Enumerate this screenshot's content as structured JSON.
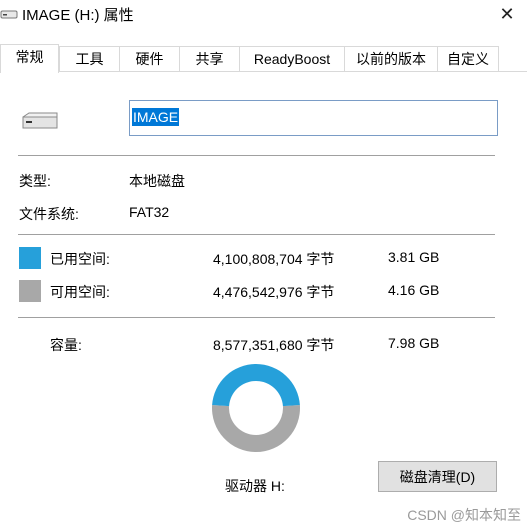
{
  "window": {
    "title": "IMAGE (H:) 属性",
    "close_glyph": "✕"
  },
  "tabs": [
    {
      "label": "常规",
      "active": true
    },
    {
      "label": "工具",
      "active": false
    },
    {
      "label": "硬件",
      "active": false
    },
    {
      "label": "共享",
      "active": false
    },
    {
      "label": "ReadyBoost",
      "active": false
    },
    {
      "label": "以前的版本",
      "active": false
    },
    {
      "label": "自定义",
      "active": false
    }
  ],
  "general": {
    "volume_name": "IMAGE",
    "type_label": "类型:",
    "type_value": "本地磁盘",
    "fs_label": "文件系统:",
    "fs_value": "FAT32",
    "used_label": "已用空间:",
    "used_bytes": "4,100,808,704 字节",
    "used_size": "3.81 GB",
    "free_label": "可用空间:",
    "free_bytes": "4,476,542,976 字节",
    "free_size": "4.16 GB",
    "capacity_label": "容量:",
    "capacity_bytes": "8,577,351,680 字节",
    "capacity_size": "7.98 GB",
    "drive_label": "驱动器 H:",
    "cleanup_button": "磁盘清理(D)"
  },
  "usage": {
    "used_fraction": 0.478,
    "used_color": "#26a0da",
    "free_color": "#a8a8a8"
  },
  "watermark": "CSDN @知本知至"
}
